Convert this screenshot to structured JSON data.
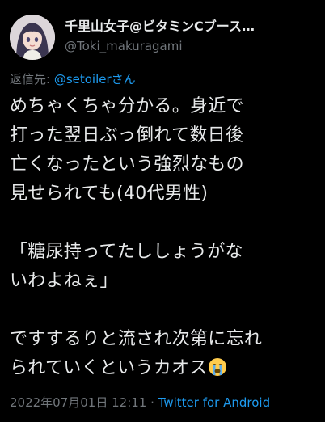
{
  "author": {
    "display_name": "千里山女子@ビタミンCブース…",
    "handle": "@Toki_makuragami"
  },
  "reply": {
    "prefix": "返信先: ",
    "mention": "@setoilerさん"
  },
  "tweet": {
    "lines": [
      "めちゃくちゃ分かる。身近で",
      "打った翌日ぶっ倒れて数日後",
      "亡くなったという強烈なもの",
      "見せられても(40代男性)",
      "",
      "「糖尿持ってたししょうがな",
      "いわよねぇ」",
      "",
      "ですするりと流され次第に忘れ",
      "られていくというカオス"
    ],
    "emoji": "crying-face-emoji"
  },
  "footer": {
    "timestamp": "2022年07月01日 12:11",
    "separator": " · ",
    "source": "Twitter for Android"
  },
  "colors": {
    "background": "#000000",
    "text": "#e7e9ea",
    "muted": "#71767b",
    "link": "#1d9bf0"
  }
}
